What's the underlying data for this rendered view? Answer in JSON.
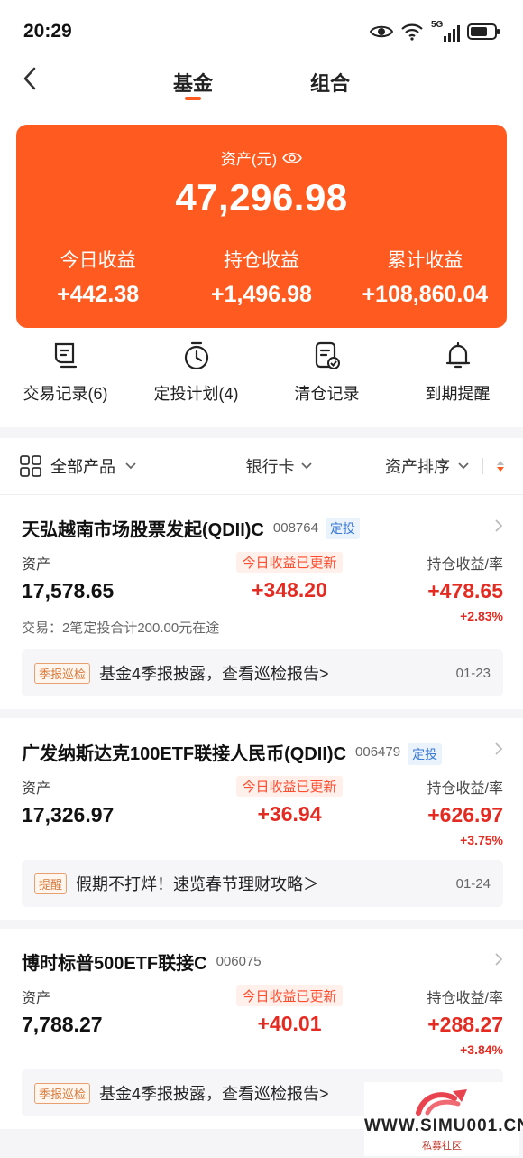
{
  "status": {
    "time": "20:29",
    "network": "5G"
  },
  "nav": {
    "tabs": [
      "基金",
      "组合"
    ],
    "active": 0
  },
  "summary": {
    "asset_label": "资产(元)",
    "asset_total": "47,296.98",
    "stats": [
      {
        "label": "今日收益",
        "value": "+442.38"
      },
      {
        "label": "持仓收益",
        "value": "+1,496.98"
      },
      {
        "label": "累计收益",
        "value": "+108,860.04"
      }
    ]
  },
  "quick_actions": [
    {
      "label": "交易记录(6)",
      "icon": "receipt-icon"
    },
    {
      "label": "定投计划(4)",
      "icon": "clock-icon"
    },
    {
      "label": "清仓记录",
      "icon": "document-check-icon"
    },
    {
      "label": "到期提醒",
      "icon": "bell-icon"
    }
  ],
  "filters": {
    "all": "全部产品",
    "bank": "银行卡",
    "sort": "资产排序"
  },
  "labels": {
    "asset": "资产",
    "updated": "今日收益已更新",
    "holding": "持仓收益/率"
  },
  "funds": [
    {
      "name": "天弘越南市场股票发起(QDII)C",
      "code": "008764",
      "tag": "定投",
      "asset": "17,578.65",
      "today": "+348.20",
      "holding": "+478.65",
      "rate": "+2.83%",
      "txn": "交易：2笔定投合计200.00元在途",
      "notice_tag": "季报巡检",
      "notice_text": "基金4季报披露，查看巡检报告>",
      "notice_date": "01-23"
    },
    {
      "name": "广发纳斯达克100ETF联接人民币(QDII)C",
      "code": "006479",
      "tag": "定投",
      "asset": "17,326.97",
      "today": "+36.94",
      "holding": "+626.97",
      "rate": "+3.75%",
      "notice_tag": "提醒",
      "notice_text": "假期不打烊！速览春节理财攻略＞",
      "notice_date": "01-24"
    },
    {
      "name": "博时标普500ETF联接C",
      "code": "006075",
      "asset": "7,788.27",
      "today": "+40.01",
      "holding": "+288.27",
      "rate": "+3.84%",
      "notice_tag": "季报巡检",
      "notice_text": "基金4季报披露，查看巡检报告>"
    }
  ],
  "watermark": {
    "text": "WWW.SIMU001.CN",
    "sub": "私募社区"
  },
  "colors": {
    "accent": "#ff5a1f",
    "gain": "#e42b21",
    "tag_blue": "#3a7bd5"
  }
}
